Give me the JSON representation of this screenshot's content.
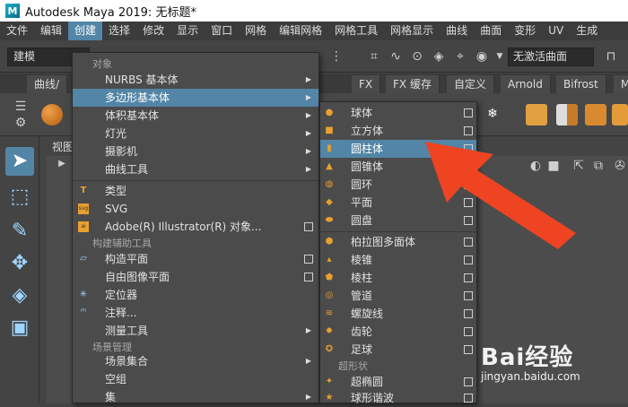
{
  "window": {
    "title": "Autodesk Maya 2019: 无标题*"
  },
  "menubar": [
    "文件",
    "编辑",
    "创建",
    "选择",
    "修改",
    "显示",
    "窗口",
    "网格",
    "编辑网格",
    "网格工具",
    "网格显示",
    "曲线",
    "曲面",
    "变形",
    "UV",
    "生成"
  ],
  "menubar_active": 2,
  "toolbar": {
    "mode": "建模",
    "no_active_surface": "无激活曲面"
  },
  "shelf_tabs": [
    "曲线/",
    "FX",
    "FX 缓存",
    "自定义",
    "Arnold",
    "Bifrost",
    "M"
  ],
  "viewport": {
    "label": "视图"
  },
  "create_menu": {
    "sections": [
      "对象",
      "构建辅助工具",
      "场景管理"
    ],
    "items": [
      {
        "label": "NURBS 基本体",
        "submenu": true
      },
      {
        "label": "多边形基本体",
        "submenu": true,
        "highlight": true
      },
      {
        "label": "体积基本体",
        "submenu": true
      },
      {
        "label": "灯光",
        "submenu": true
      },
      {
        "label": "摄影机",
        "submenu": true
      },
      {
        "label": "曲线工具",
        "submenu": true
      },
      {
        "label": "类型",
        "icon": "type-icon"
      },
      {
        "label": "SVG",
        "icon": "svg-icon"
      },
      {
        "label": "Adobe(R) Illustrator(R) 对象...",
        "option_box": true
      },
      {
        "label": "构造平面",
        "option_box": true,
        "icon": "plane-icon"
      },
      {
        "label": "自由图像平面",
        "option_box": true
      },
      {
        "label": "定位器",
        "icon": "locator-icon"
      },
      {
        "label": "注释...",
        "icon": "annotation-icon"
      },
      {
        "label": "测量工具",
        "submenu": true
      },
      {
        "label": "场景集合",
        "submenu": true
      },
      {
        "label": "空组"
      },
      {
        "label": "集",
        "submenu": true
      }
    ]
  },
  "poly_menu": {
    "section": "超形状",
    "items": [
      {
        "label": "球体",
        "icon": "sphere-icon"
      },
      {
        "label": "立方体",
        "icon": "cube-icon"
      },
      {
        "label": "圆柱体",
        "icon": "cylinder-icon",
        "highlight": true
      },
      {
        "label": "圆锥体",
        "icon": "cone-icon"
      },
      {
        "label": "圆环",
        "icon": "torus-icon"
      },
      {
        "label": "平面",
        "icon": "plane-icon"
      },
      {
        "label": "圆盘",
        "icon": "disc-icon"
      },
      {
        "label": "柏拉图多面体",
        "icon": "platonic-icon"
      },
      {
        "label": "棱锥",
        "icon": "pyramid-icon"
      },
      {
        "label": "棱柱",
        "icon": "prism-icon"
      },
      {
        "label": "管道",
        "icon": "pipe-icon"
      },
      {
        "label": "螺旋线",
        "icon": "helix-icon"
      },
      {
        "label": "齿轮",
        "icon": "gear-icon"
      },
      {
        "label": "足球",
        "icon": "soccer-ball-icon"
      },
      {
        "label": "超椭圆",
        "icon": "superellipse-icon"
      },
      {
        "label": "球形谐波",
        "icon": "spherical-harmonics-icon"
      }
    ]
  },
  "watermark": {
    "brand": "Bai经验",
    "url": "jingyan.baidu.com"
  },
  "colors": {
    "highlight": "#5285a6",
    "annotation_arrow": "#ee4422"
  }
}
